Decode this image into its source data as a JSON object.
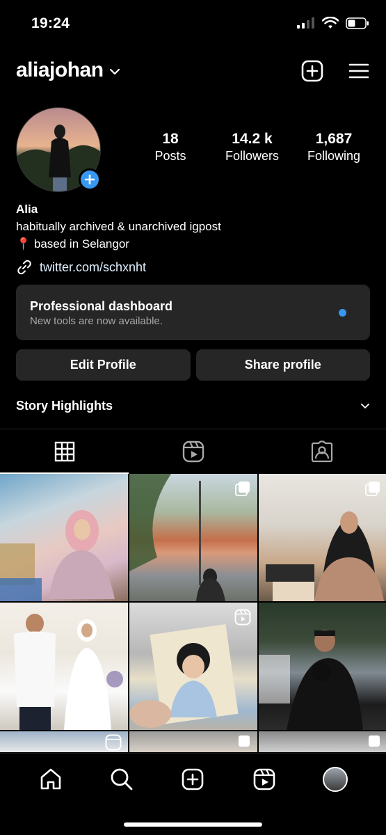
{
  "status": {
    "time": "19:24"
  },
  "header": {
    "username": "aliajohan"
  },
  "profile": {
    "stats": [
      {
        "value": "18",
        "label": "Posts"
      },
      {
        "value": "14.2 k",
        "label": "Followers"
      },
      {
        "value": "1,687",
        "label": "Following"
      }
    ],
    "name": "Alia",
    "bio_line1": "habitually archived & unarchived igpost",
    "bio_line2": "📍 based in Selangor",
    "link": "twitter.com/schxnht"
  },
  "dashboard": {
    "title": "Professional dashboard",
    "subtitle": "New tools are now available."
  },
  "buttons": {
    "edit": "Edit Profile",
    "share": "Share profile"
  },
  "highlights": {
    "label": "Story Highlights"
  },
  "colors": {
    "accent": "#3897f0",
    "card": "#262626",
    "background": "#000000"
  },
  "icons": [
    "grid-icon",
    "reels-icon",
    "tagged-icon",
    "home-icon",
    "search-icon",
    "add-icon",
    "reels-nav-icon"
  ]
}
